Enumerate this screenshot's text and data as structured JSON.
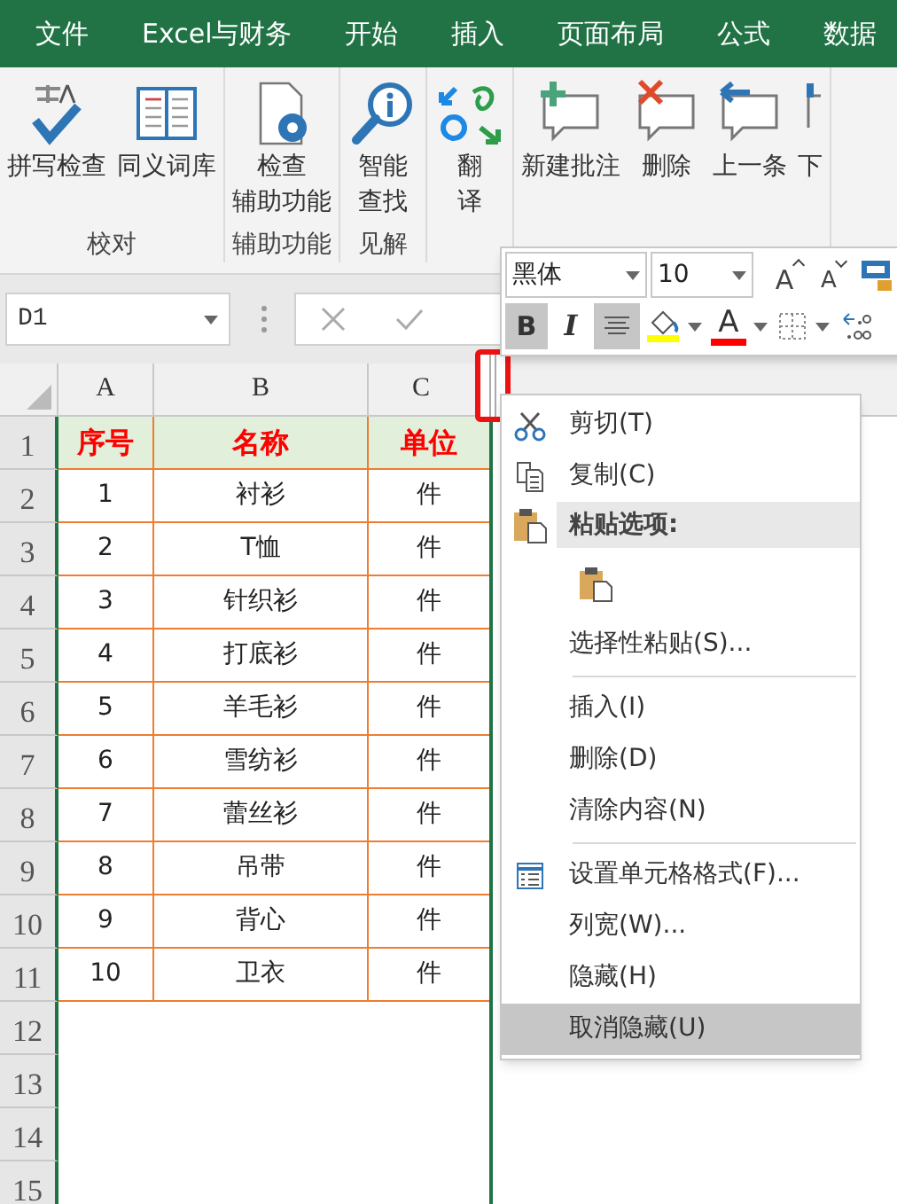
{
  "tabs": [
    {
      "label": "文件",
      "selected": false
    },
    {
      "label": "Excel与财务",
      "selected": false
    },
    {
      "label": "开始",
      "selected": false
    },
    {
      "label": "插入",
      "selected": false
    },
    {
      "label": "页面布局",
      "selected": false
    },
    {
      "label": "公式",
      "selected": false
    },
    {
      "label": "数据",
      "selected": false
    }
  ],
  "ribbon": {
    "groups": [
      {
        "label": "校对",
        "buttons": [
          {
            "lines": [
              "拼写检查"
            ]
          },
          {
            "lines": [
              "同义词库"
            ]
          }
        ]
      },
      {
        "label": "辅助功能",
        "buttons": [
          {
            "lines": [
              "检查",
              "辅助功能"
            ]
          }
        ]
      },
      {
        "label": "见解",
        "buttons": [
          {
            "lines": [
              "智能",
              "查找"
            ]
          }
        ]
      },
      {
        "buttons": [
          {
            "lines": [
              "翻",
              "译"
            ]
          }
        ]
      },
      {
        "buttons": [
          {
            "lines": [
              "新建批注"
            ]
          },
          {
            "lines": [
              "删除"
            ]
          },
          {
            "lines": [
              "上一条"
            ]
          },
          {
            "lines": [
              "下"
            ]
          }
        ]
      }
    ]
  },
  "name_box": {
    "value": "D1"
  },
  "mini_toolbar": {
    "font": {
      "value": "黑体"
    },
    "size": {
      "value": "10"
    },
    "row_1": [
      {
        "kind": "grow",
        "label": "A"
      },
      {
        "kind": "shrink",
        "label": "A"
      },
      {
        "kind": "format-painter"
      }
    ],
    "row_2": [
      {
        "kind": "bold",
        "label": "B",
        "selected": true
      },
      {
        "kind": "italic",
        "label": "I",
        "selected": false
      },
      {
        "kind": "align",
        "selected": true
      },
      {
        "kind": "fill",
        "color": "#ffff00"
      },
      {
        "kind": "font-color",
        "label": "A",
        "color": "#ff0000"
      },
      {
        "kind": "borders"
      },
      {
        "kind": "decimal"
      }
    ]
  },
  "sheet": {
    "columns": [
      "A",
      "B",
      "C"
    ],
    "rows": [
      {
        "number": "1",
        "kind": "header",
        "cells": [
          "序号",
          "名称",
          "单位"
        ]
      },
      {
        "number": "2",
        "kind": "data",
        "cells": [
          "1",
          "衬衫",
          "件"
        ]
      },
      {
        "number": "3",
        "kind": "data",
        "cells": [
          "2",
          "T恤",
          "件"
        ]
      },
      {
        "number": "4",
        "kind": "data",
        "cells": [
          "3",
          "针织衫",
          "件"
        ]
      },
      {
        "number": "5",
        "kind": "data",
        "cells": [
          "4",
          "打底衫",
          "件"
        ]
      },
      {
        "number": "6",
        "kind": "data",
        "cells": [
          "5",
          "羊毛衫",
          "件"
        ]
      },
      {
        "number": "7",
        "kind": "data",
        "cells": [
          "6",
          "雪纺衫",
          "件"
        ]
      },
      {
        "number": "8",
        "kind": "data",
        "cells": [
          "7",
          "蕾丝衫",
          "件"
        ]
      },
      {
        "number": "9",
        "kind": "data",
        "cells": [
          "8",
          "吊带",
          "件"
        ]
      },
      {
        "number": "10",
        "kind": "data",
        "cells": [
          "9",
          "背心",
          "件"
        ]
      },
      {
        "number": "11",
        "kind": "data",
        "cells": [
          "10",
          "卫衣",
          "件"
        ]
      },
      {
        "number": "12",
        "kind": "empty"
      },
      {
        "number": "13",
        "kind": "empty"
      },
      {
        "number": "14",
        "kind": "empty"
      },
      {
        "number": "15",
        "kind": "empty"
      }
    ]
  },
  "context_menu": [
    {
      "kind": "item",
      "label": "剪切(T)",
      "selected": false
    },
    {
      "kind": "item",
      "label": "复制(C)",
      "selected": false
    },
    {
      "kind": "heading",
      "label": "粘贴选项:"
    },
    {
      "kind": "paste-option"
    },
    {
      "kind": "item",
      "label": "选择性粘贴(S)...",
      "selected": false
    },
    {
      "kind": "separator"
    },
    {
      "kind": "item",
      "label": "插入(I)",
      "selected": false
    },
    {
      "kind": "item",
      "label": "删除(D)",
      "selected": false
    },
    {
      "kind": "item",
      "label": "清除内容(N)",
      "selected": false
    },
    {
      "kind": "separator"
    },
    {
      "kind": "item",
      "label": "设置单元格格式(F)...",
      "selected": false
    },
    {
      "kind": "item",
      "label": "列宽(W)...",
      "selected": false
    },
    {
      "kind": "item",
      "label": "隐藏(H)",
      "selected": false
    },
    {
      "kind": "item",
      "label": "取消隐藏(U)",
      "selected": true
    }
  ]
}
